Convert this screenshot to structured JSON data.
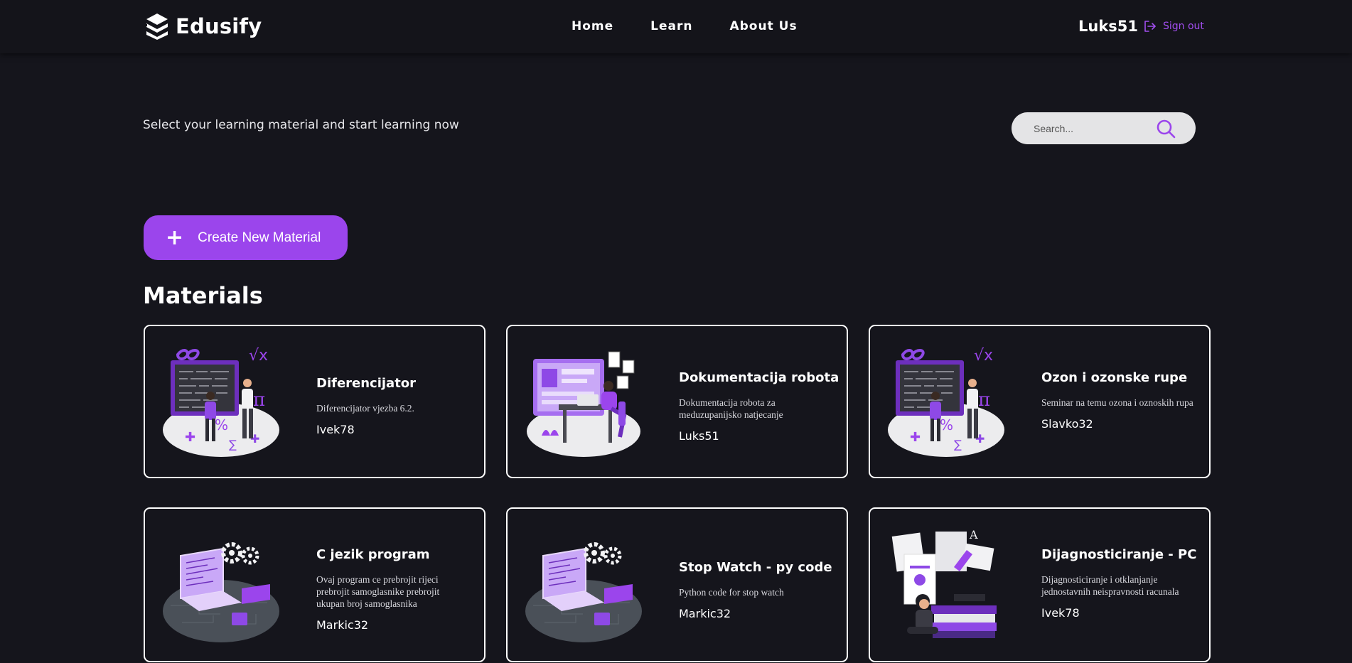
{
  "brand": {
    "name": "Edusify"
  },
  "nav": {
    "links": [
      "Home",
      "Learn",
      "About Us"
    ]
  },
  "user": {
    "name": "Luks51",
    "signout_label": "Sign out"
  },
  "hero": {
    "tagline": "Select your learning material and start learning now"
  },
  "search": {
    "placeholder": "Search..."
  },
  "actions": {
    "create_label": "Create New Material"
  },
  "materials": {
    "heading": "Materials",
    "items": [
      {
        "title": "Diferencijator",
        "description": "Diferencijator vjezba 6.2.",
        "author": "Ivek78",
        "illustration": "teacher-math-board-illustration"
      },
      {
        "title": "Dokumentacija robota",
        "description": "Dokumentacija robota za meduzupanijsko natjecanje",
        "author": "Luks51",
        "illustration": "desk-computer-illustration"
      },
      {
        "title": "Ozon i ozonske rupe",
        "description": "Seminar na temu ozona i oznoskih rupa",
        "author": "Slavko32",
        "illustration": "teacher-math-board-illustration"
      },
      {
        "title": "C jezik program",
        "description": "Ovaj program ce prebrojit rijeci prebrojit samoglasnike prebrojit ukupan broj samoglasnika",
        "author": "Markic32",
        "illustration": "laptop-gears-illustration"
      },
      {
        "title": "Stop Watch - py code",
        "description": "Python code for stop watch",
        "author": "Markic32",
        "illustration": "laptop-gears-illustration"
      },
      {
        "title": "Dijagnosticiranje - PC",
        "description": "Dijagnosticiranje i otklanjanje jednostavnih neispravnosti racunala",
        "author": "Ivek78",
        "illustration": "books-reader-illustration"
      }
    ]
  },
  "colors": {
    "accent": "#9b45ec",
    "background": "#15151c",
    "navbar": "#14141a"
  }
}
